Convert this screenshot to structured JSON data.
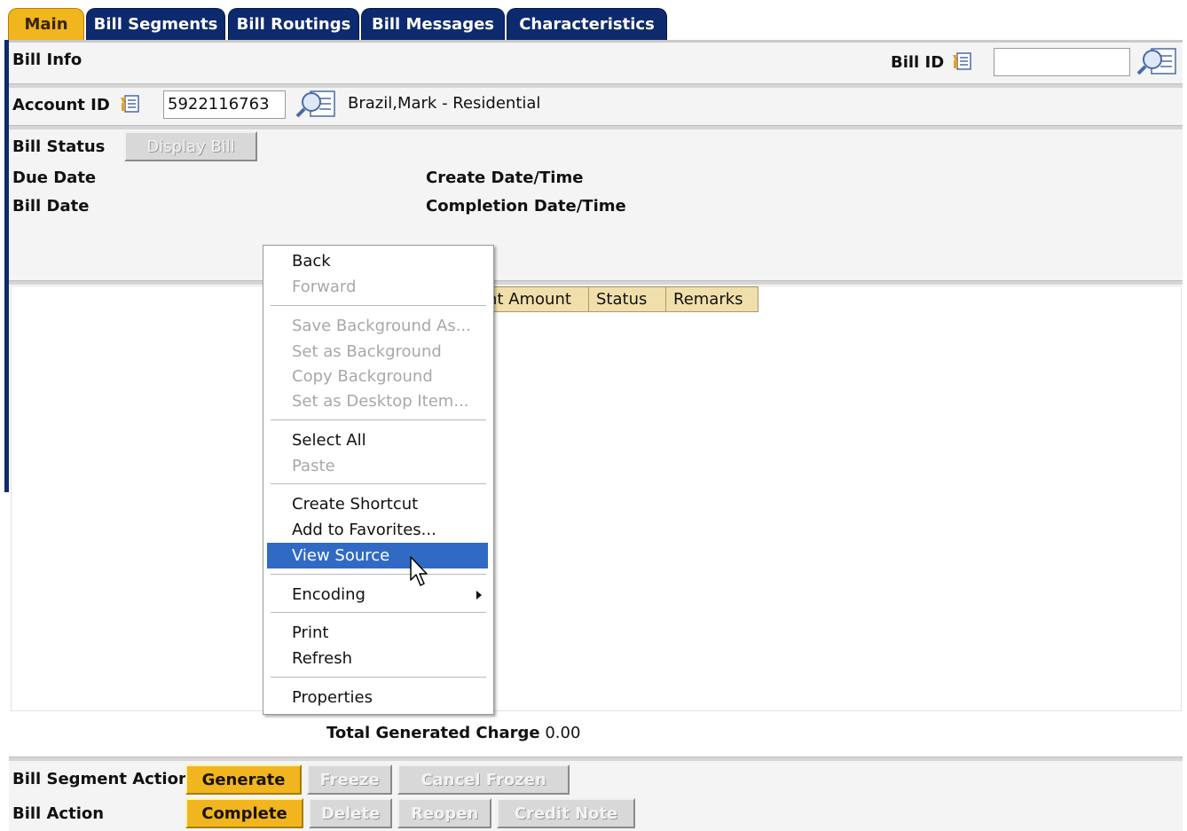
{
  "tabs": [
    {
      "label": "Main",
      "active": true
    },
    {
      "label": "Bill Segments",
      "active": false
    },
    {
      "label": "Bill Routings",
      "active": false
    },
    {
      "label": "Bill Messages",
      "active": false
    },
    {
      "label": "Characteristics",
      "active": false
    }
  ],
  "bill_info": {
    "title": "Bill Info",
    "bill_id_label": "Bill ID",
    "bill_id_value": ""
  },
  "account": {
    "label": "Account ID",
    "value": "5922116763",
    "name": "Brazil,Mark",
    "type": " - Residential"
  },
  "status": {
    "bill_status_label": "Bill Status",
    "display_bill_button": "Display Bill",
    "due_date_label": "Due Date",
    "bill_date_label": "Bill Date",
    "create_label": "Create Date/Time",
    "completion_label": "Completion Date/Time"
  },
  "grid": {
    "columns": [
      "nt Amount",
      "Status",
      "Remarks"
    ]
  },
  "total": {
    "label": "Total Generated Charge",
    "value": "0.00"
  },
  "actions": {
    "segment_label": "Bill Segment Action",
    "generate": "Generate",
    "freeze": "Freeze",
    "cancel_frozen": "Cancel Frozen",
    "bill_label": "Bill Action",
    "complete": "Complete",
    "delete": "Delete",
    "reopen": "Reopen",
    "credit_note": "Credit Note"
  },
  "context_menu": {
    "items": [
      {
        "label": "Back",
        "enabled": true
      },
      {
        "label": "Forward",
        "enabled": false
      },
      {
        "label": "Save Background As...",
        "enabled": false
      },
      {
        "label": "Set as Background",
        "enabled": false
      },
      {
        "label": "Copy Background",
        "enabled": false
      },
      {
        "label": "Set as Desktop Item...",
        "enabled": false
      },
      {
        "label": "Select All",
        "enabled": true
      },
      {
        "label": "Paste",
        "enabled": false
      },
      {
        "label": "Create Shortcut",
        "enabled": true
      },
      {
        "label": "Add to Favorites...",
        "enabled": true
      },
      {
        "label": "View Source",
        "enabled": true,
        "highlighted": true
      },
      {
        "label": "Encoding",
        "enabled": true,
        "submenu": true
      },
      {
        "label": "Print",
        "enabled": true
      },
      {
        "label": "Refresh",
        "enabled": true
      },
      {
        "label": "Properties",
        "enabled": true
      }
    ]
  },
  "colors": {
    "tab_active": "#f0b51f",
    "tab_inactive": "#0e2a6e",
    "menu_highlight": "#316ac5",
    "grid_header": "#f1dfab",
    "button_gold": "#f0b51f"
  },
  "icons": [
    "context-menu-icon",
    "search-lookup-icon",
    "submenu-arrow-icon",
    "mouse-pointer-icon"
  ]
}
